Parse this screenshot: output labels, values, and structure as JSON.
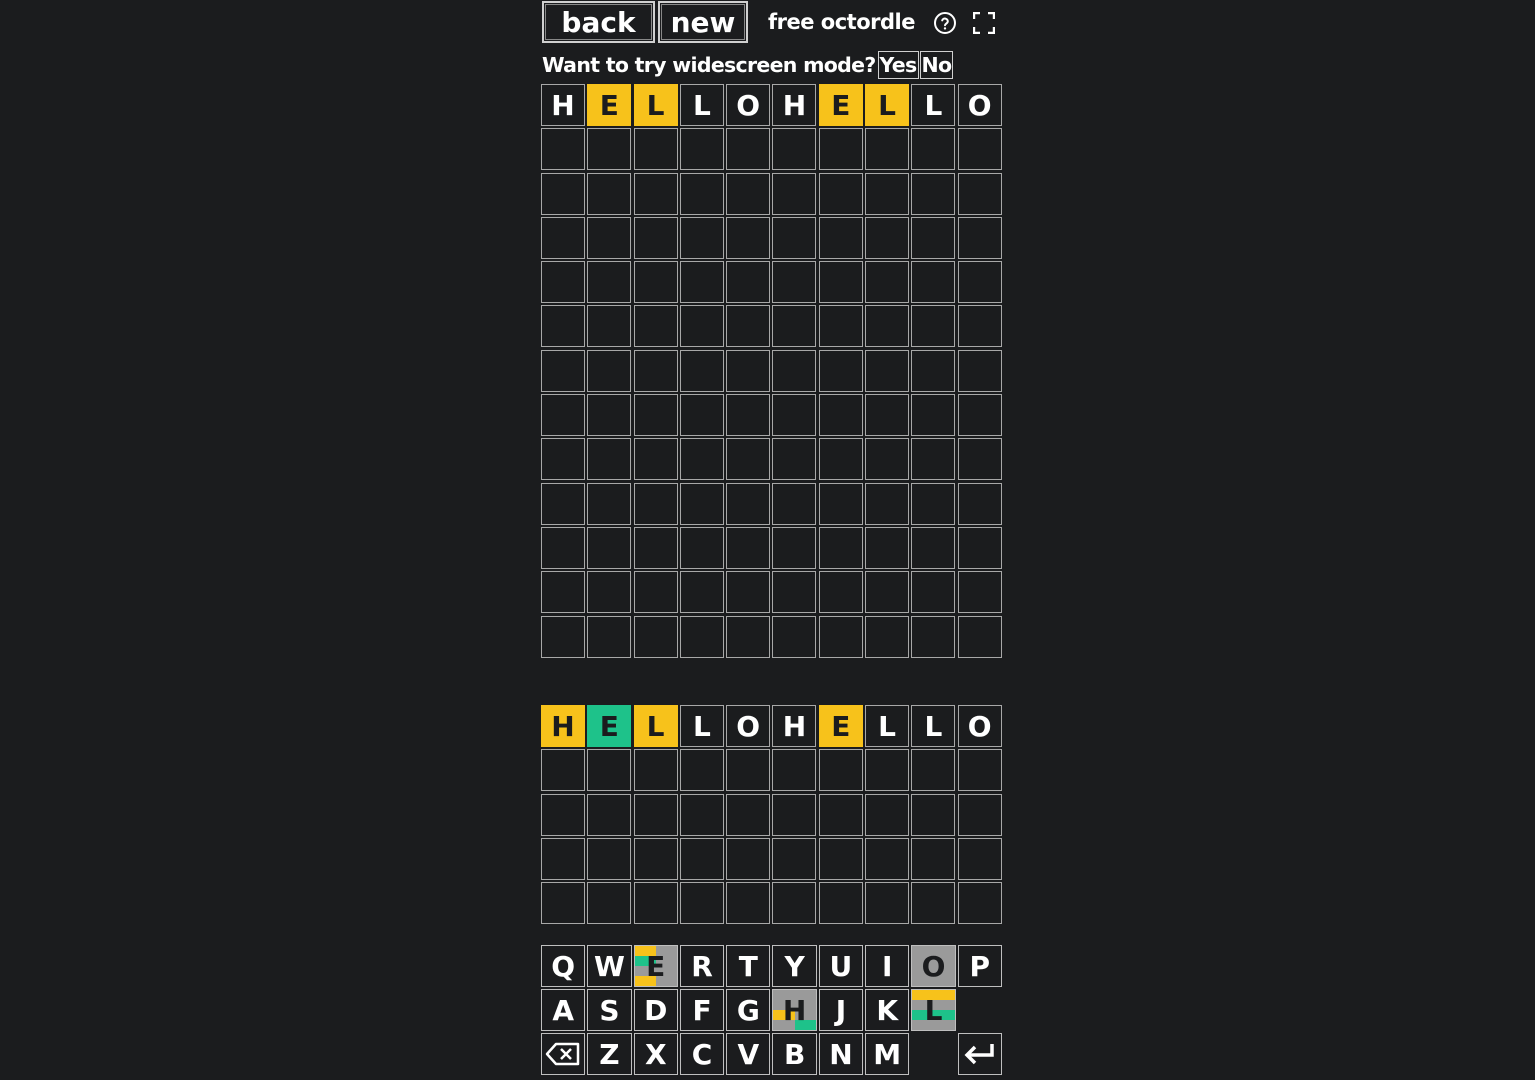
{
  "header": {
    "back_label": "back",
    "new_label": "new",
    "title": "free octordle",
    "help_icon": "help-circle-icon",
    "fullscreen_icon": "fullscreen-icon"
  },
  "widescreen": {
    "prompt": "Want to try widescreen mode?",
    "yes_label": "Yes",
    "no_label": "No"
  },
  "colors": {
    "background": "#1b1c1e",
    "present": "#f7c21b",
    "correct": "#1ec28a",
    "absent": "#9a9a9a",
    "cell_border": "#a8a8a8"
  },
  "boards": [
    {
      "guess": [
        "H",
        "E",
        "L",
        "L",
        "O",
        "H",
        "E",
        "L",
        "L",
        "O"
      ],
      "states": [
        "",
        "y",
        "y",
        "",
        "",
        "",
        "y",
        "y",
        "",
        ""
      ],
      "empty_rows": 12
    },
    {
      "guess": [
        "H",
        "E",
        "L",
        "L",
        "O",
        "H",
        "E",
        "L",
        "L",
        "O"
      ],
      "states": [
        "y",
        "g",
        "y",
        "",
        "",
        "",
        "y",
        "",
        "",
        ""
      ],
      "empty_rows": 4
    }
  ],
  "keyboard": {
    "rows": [
      [
        {
          "k": "Q"
        },
        {
          "k": "W"
        },
        {
          "k": "E",
          "split": [
            "#f7c21b",
            "#9a9a9a",
            "#1ec28a",
            "#9a9a9a",
            "#9a9a9a",
            "#9a9a9a",
            "#f7c21b",
            "#9a9a9a"
          ]
        },
        {
          "k": "R"
        },
        {
          "k": "T"
        },
        {
          "k": "Y"
        },
        {
          "k": "U"
        },
        {
          "k": "I"
        },
        {
          "k": "O",
          "split": [
            "#9a9a9a",
            "#9a9a9a",
            "#9a9a9a",
            "#9a9a9a",
            "#9a9a9a",
            "#9a9a9a",
            "#9a9a9a",
            "#9a9a9a"
          ]
        },
        {
          "k": "P"
        }
      ],
      [
        {
          "k": "A"
        },
        {
          "k": "S"
        },
        {
          "k": "D"
        },
        {
          "k": "F"
        },
        {
          "k": "G"
        },
        {
          "k": "H",
          "split": [
            "#9a9a9a",
            "#9a9a9a",
            "#9a9a9a",
            "#9a9a9a",
            "#f7c21b",
            "#9a9a9a",
            "#9a9a9a",
            "#1ec28a"
          ]
        },
        {
          "k": "J"
        },
        {
          "k": "K"
        },
        {
          "k": "L",
          "split": [
            "#f7c21b",
            "#f7c21b",
            "#9a9a9a",
            "#9a9a9a",
            "#1ec28a",
            "#1ec28a",
            "#9a9a9a",
            "#9a9a9a"
          ]
        },
        {
          "k": "",
          "blank": true
        }
      ],
      [
        {
          "k": "",
          "icon": "backspace-icon"
        },
        {
          "k": "Z"
        },
        {
          "k": "X"
        },
        {
          "k": "C"
        },
        {
          "k": "V"
        },
        {
          "k": "B"
        },
        {
          "k": "N"
        },
        {
          "k": "M"
        },
        {
          "k": "",
          "blank": true
        },
        {
          "k": "",
          "icon": "enter-icon"
        }
      ]
    ]
  }
}
